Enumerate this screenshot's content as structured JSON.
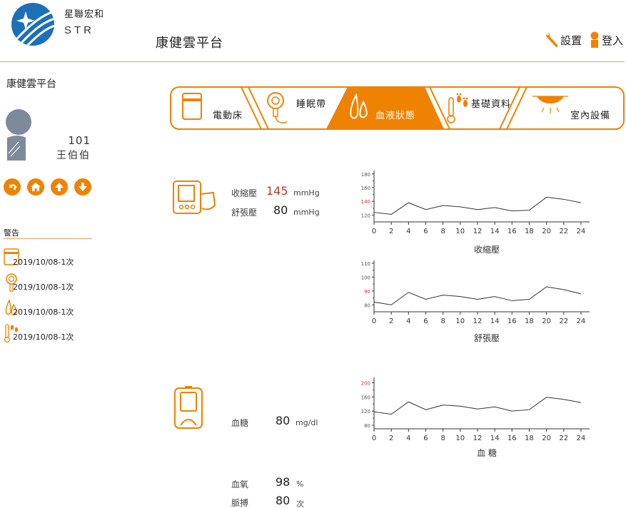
{
  "brand": {
    "cn": "星聯宏和",
    "en": "STR"
  },
  "header": {
    "title": "康健雲平台",
    "settings_label": "設置",
    "login_label": "登入"
  },
  "sidebar": {
    "title": "康健雲平台",
    "room": "101",
    "name": "王伯伯",
    "warning_title": "警告",
    "alerts": [
      {
        "icon": "bed-icon",
        "text": "2019/10/08-1次"
      },
      {
        "icon": "sleep-band-icon",
        "text": "2019/10/08-1次"
      },
      {
        "icon": "blood-drop-icon",
        "text": "2019/10/08-1次"
      },
      {
        "icon": "thermometer-feet-icon",
        "text": "2019/10/08-1次"
      }
    ]
  },
  "tabs": [
    {
      "label": "電動床",
      "icon": "bed-icon",
      "active": false
    },
    {
      "label": "睡眠帶",
      "icon": "sleep-band-icon",
      "active": false
    },
    {
      "label": "血液狀態",
      "icon": "blood-drop-icon",
      "active": true
    },
    {
      "label": "基礎資料",
      "icon": "thermometer-feet-icon",
      "active": false
    },
    {
      "label": "室內設備",
      "icon": "lamp-icon",
      "active": false
    }
  ],
  "colors": {
    "accent": "#ef8200",
    "line": "#e8a35a",
    "alert_tick": "#c0392b"
  },
  "readings": {
    "systolic": {
      "label": "收縮壓",
      "value": "145",
      "unit": "mmHg"
    },
    "diastolic": {
      "label": "舒張壓",
      "value": "80",
      "unit": "mmHg"
    },
    "glucose": {
      "label": "血糖",
      "value": "80",
      "unit": "mg/dl"
    },
    "oxygen": {
      "label": "血氧",
      "value": "98",
      "unit": "%"
    },
    "pulse": {
      "label": "脈搏",
      "value": "80",
      "unit": "次"
    }
  },
  "chart_data": [
    {
      "type": "line",
      "title": "收縮壓",
      "x": [
        0,
        2,
        4,
        6,
        8,
        10,
        12,
        14,
        16,
        18,
        20,
        22,
        24
      ],
      "xticks": [
        "0",
        "2",
        "4",
        "6",
        "8",
        "10",
        "12",
        "14",
        "16",
        "18",
        "20",
        "22",
        "24"
      ],
      "series": [
        {
          "values": [
            [
              0,
              124
            ],
            [
              2,
              121
            ],
            [
              4,
              138
            ],
            [
              6,
              128
            ],
            [
              8,
              134
            ],
            [
              10,
              132
            ],
            [
              12,
              128
            ],
            [
              14,
              131
            ],
            [
              16,
              126
            ],
            [
              18,
              127
            ],
            [
              20,
              146
            ],
            [
              22,
              143
            ],
            [
              24,
              138
            ]
          ]
        }
      ],
      "yticks": [
        120,
        140,
        160,
        180
      ],
      "highlight_tick": 140,
      "ylim": [
        110,
        185
      ],
      "xlim": [
        0,
        25
      ]
    },
    {
      "type": "line",
      "title": "舒張壓",
      "x": [
        0,
        2,
        4,
        6,
        8,
        10,
        12,
        14,
        16,
        18,
        20,
        22,
        24
      ],
      "xticks": [
        "0",
        "2",
        "4",
        "6",
        "8",
        "10",
        "12",
        "14",
        "16",
        "18",
        "20",
        "22",
        "24"
      ],
      "series": [
        {
          "values": [
            [
              0,
              82
            ],
            [
              2,
              80
            ],
            [
              4,
              89
            ],
            [
              6,
              84
            ],
            [
              8,
              87
            ],
            [
              10,
              86
            ],
            [
              12,
              84
            ],
            [
              14,
              86
            ],
            [
              16,
              83
            ],
            [
              18,
              84
            ],
            [
              20,
              93
            ],
            [
              22,
              91
            ],
            [
              24,
              88
            ]
          ]
        }
      ],
      "yticks": [
        80,
        90,
        100,
        110
      ],
      "highlight_tick": 90,
      "ylim": [
        75,
        112
      ],
      "xlim": [
        0,
        25
      ]
    },
    {
      "type": "line",
      "title": "血  糖",
      "x": [
        0,
        2,
        4,
        6,
        8,
        10,
        12,
        14,
        16,
        18,
        20,
        22,
        24
      ],
      "xticks": [
        "0",
        "2",
        "4",
        "6",
        "8",
        "10",
        "12",
        "14",
        "16",
        "18",
        "20",
        "22",
        "24"
      ],
      "series": [
        {
          "values": [
            [
              0,
              118
            ],
            [
              2,
              111
            ],
            [
              4,
              146
            ],
            [
              6,
              124
            ],
            [
              8,
              137
            ],
            [
              10,
              134
            ],
            [
              12,
              126
            ],
            [
              14,
              132
            ],
            [
              16,
              120
            ],
            [
              18,
              124
            ],
            [
              20,
              159
            ],
            [
              22,
              153
            ],
            [
              24,
              144
            ]
          ]
        }
      ],
      "yticks": [
        80,
        120,
        160,
        200
      ],
      "highlight_tick": 200,
      "ylim": [
        70,
        215
      ],
      "xlim": [
        0,
        25
      ]
    }
  ]
}
